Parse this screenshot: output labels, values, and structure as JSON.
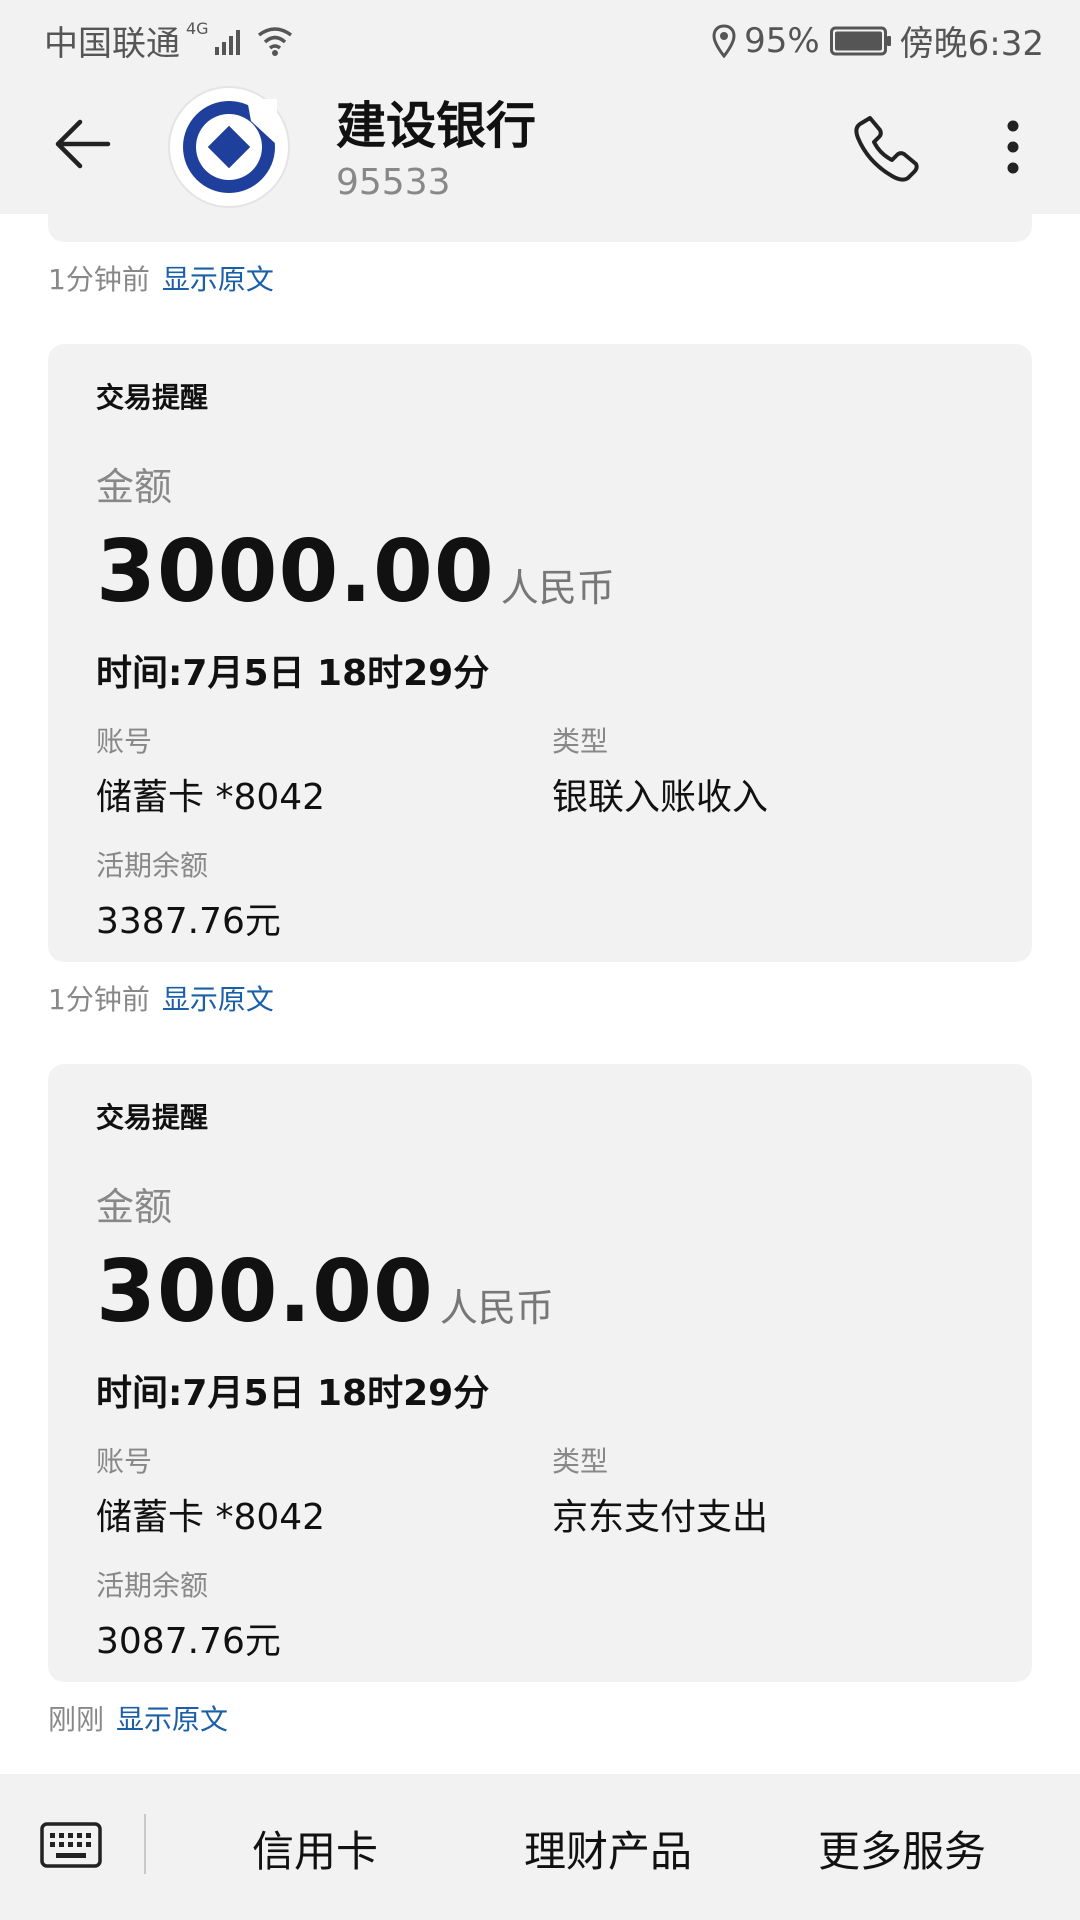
{
  "status_bar": {
    "carrier": "中国联通",
    "network": "4G",
    "battery": "95%",
    "time": "傍晚6:32"
  },
  "header": {
    "title": "建设银行",
    "subtitle": "95533"
  },
  "messages": [
    {
      "meta_time": "1分钟前",
      "meta_link": "显示原文"
    },
    {
      "card": {
        "title": "交易提醒",
        "amount_label": "金额",
        "amount": "3000.00",
        "currency": "人民币",
        "time_text": "时间:7月5日 18时29分",
        "account_label": "账号",
        "account_value": "储蓄卡 *8042",
        "type_label": "类型",
        "type_value": "银联入账收入",
        "balance_label": "活期余额",
        "balance_value": "3387.76元"
      },
      "meta_time": "1分钟前",
      "meta_link": "显示原文"
    },
    {
      "card": {
        "title": "交易提醒",
        "amount_label": "金额",
        "amount": "300.00",
        "currency": "人民币",
        "time_text": "时间:7月5日 18时29分",
        "account_label": "账号",
        "account_value": "储蓄卡 *8042",
        "type_label": "类型",
        "type_value": "京东支付支出",
        "balance_label": "活期余额",
        "balance_value": "3087.76元"
      },
      "meta_time": "刚刚",
      "meta_link": "显示原文"
    }
  ],
  "bottom_menu": {
    "items": [
      "信用卡",
      "理财产品",
      "更多服务"
    ]
  },
  "icons": {
    "back": "arrow-left-icon",
    "phone": "phone-icon",
    "more": "more-vertical-icon",
    "keyboard": "keyboard-icon",
    "location": "location-icon",
    "wifi": "wifi-icon",
    "signal": "signal-icon",
    "battery": "battery-icon"
  },
  "colors": {
    "link": "#1a5fa8",
    "brand": "#1e3f9b",
    "card_bg": "#f2f2f2"
  }
}
